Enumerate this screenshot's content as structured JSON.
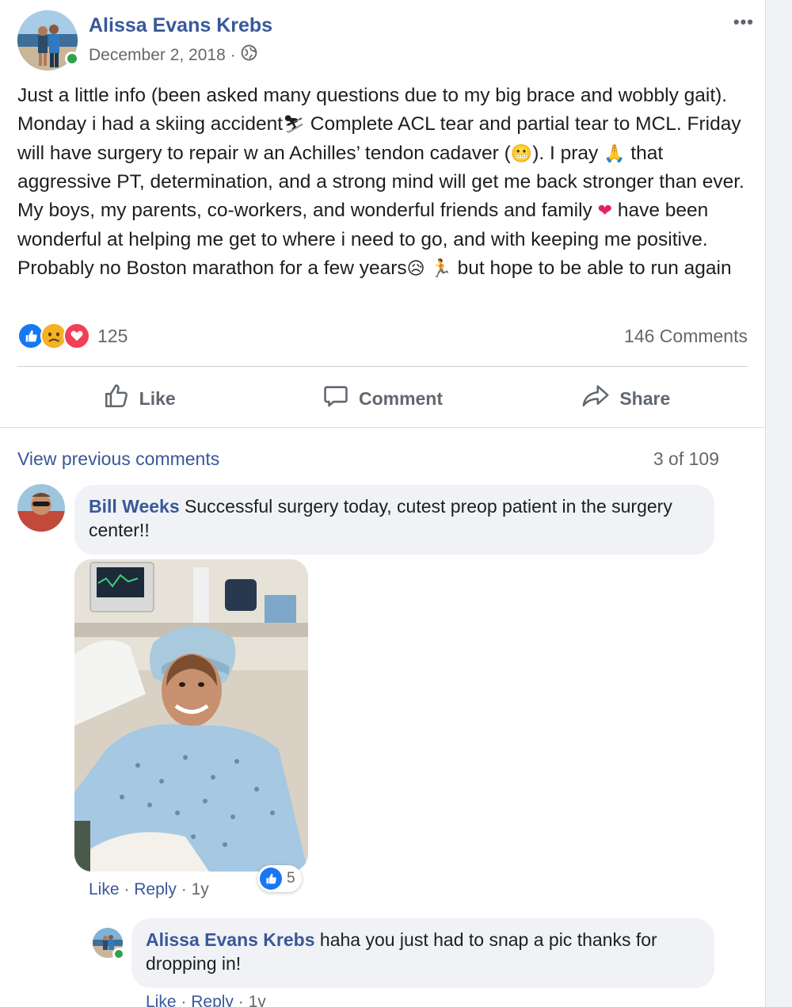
{
  "post": {
    "author": "Alissa Evans Krebs",
    "date": "December 2, 2018",
    "meta_separator": "·",
    "privacy_icon": "globe-icon",
    "more_icon": "more-horizontal-icon",
    "more_label": "•••",
    "text": {
      "p1": "Just a little info (been asked many questions due to my big brace and wobbly gait). Monday i had a skiing accident",
      "emoji_skier": "⛷",
      "p2": " Complete ACL tear and partial tear to MCL. Friday will have surgery to repair w an Achilles’ tendon cadaver (",
      "emoji_grimace": "😬",
      "p3": "). I pray ",
      "emoji_pray": "🙏",
      "p4": " that aggressive PT, determination, and a strong mind will get me back stronger than ever. My boys, my parents, co-workers, and wonderful friends and family ",
      "emoji_heart": "❤",
      "p5": " have been wonderful at helping me get to where i need to go, and with keeping me positive. Probably no Boston marathon for a few years",
      "emoji_sad": "😥",
      "emoji_runner": "🏃",
      "p6": " but hope to be able to run again"
    },
    "reaction_count": "125",
    "reaction_types": [
      "like",
      "sad",
      "love"
    ],
    "comment_count": "146 Comments",
    "actions": {
      "like": "Like",
      "comment": "Comment",
      "share": "Share"
    }
  },
  "comments_section": {
    "view_previous": "View previous comments",
    "page_count": "3 of 109",
    "comments": [
      {
        "author": "Bill Weeks",
        "text": " Successful surgery today, cutest preop patient in the surgery center!!",
        "like_count": "5",
        "actions": {
          "like": "Like",
          "reply": "Reply",
          "age": "1y"
        }
      },
      {
        "author": "Alissa Evans Krebs",
        "text": " haha you just had to snap a pic thanks for dropping in!",
        "actions": {
          "like": "Like",
          "reply": "Reply",
          "age": "1y"
        }
      }
    ],
    "separator": "·"
  },
  "colors": {
    "link_blue": "#385898",
    "like_blue": "#1877f2",
    "sad_yellow": "#f7b125",
    "love_red": "#f33e58",
    "online_green": "#31a24c",
    "muted_text": "#65676b",
    "bubble_bg": "#f0f2f5"
  }
}
